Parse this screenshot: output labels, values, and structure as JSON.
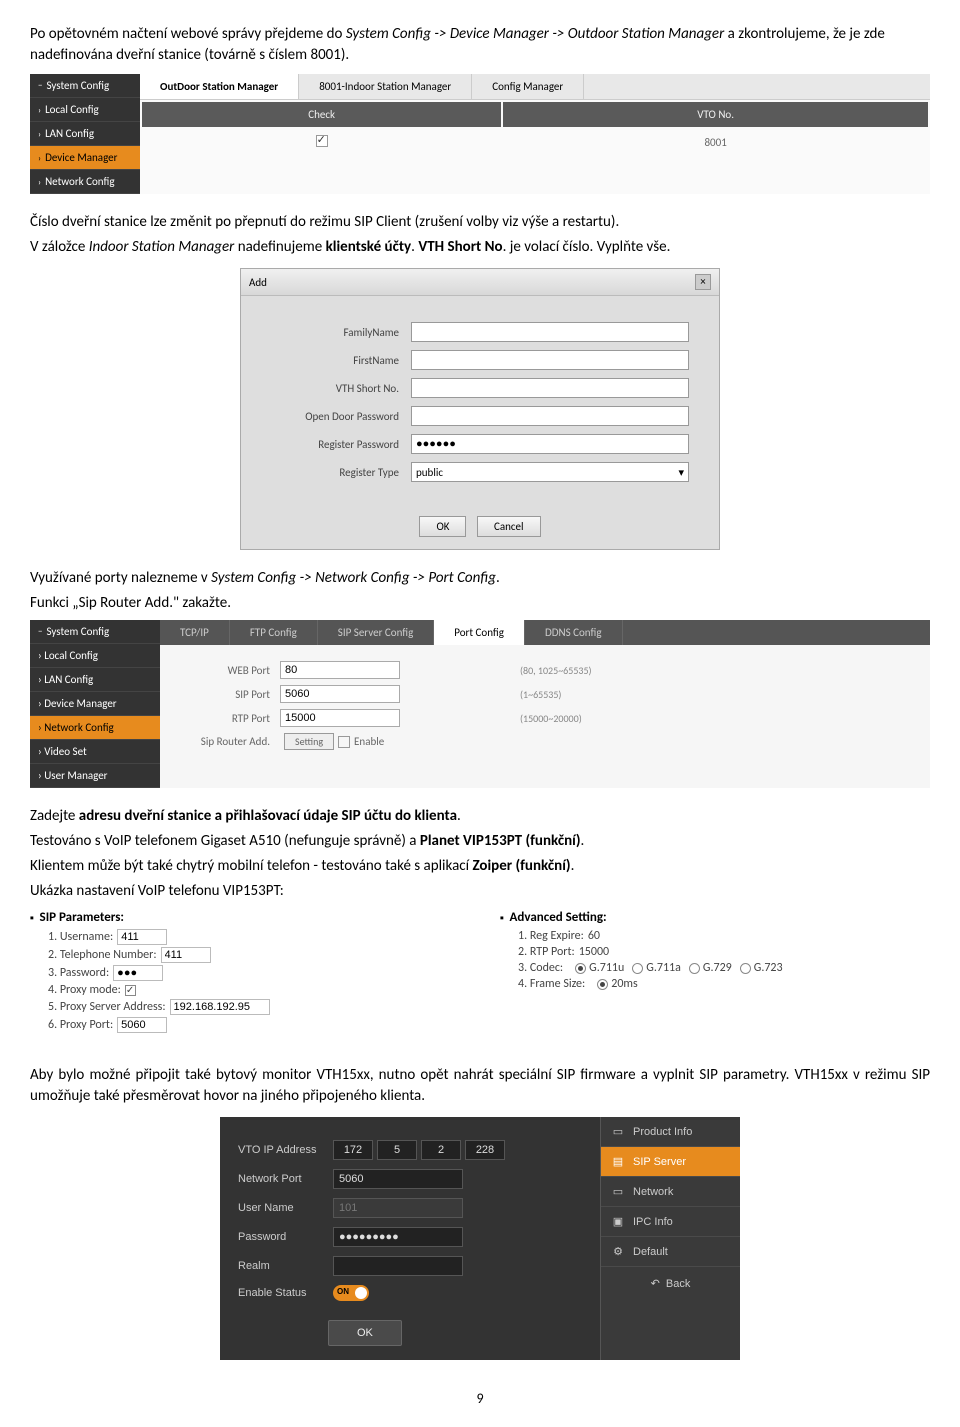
{
  "p1": "Po opětovném načtení webové správy přejdeme do ",
  "p1_italic": "System Config -> Device Manager -> Outdoor Station Manager",
  "p1_end": " a zkontrolujeme, že je zde nadefinována dveřní stanice (továrně s číslem 8001).",
  "shot1": {
    "side_title": "System Config",
    "side_items": [
      "Local Config",
      "LAN Config",
      "Device Manager",
      "Network Config"
    ],
    "side_active_index": 2,
    "tabs": [
      "OutDoor Station Manager",
      "8001-Indoor Station Manager",
      "Config Manager"
    ],
    "tab_active_index": 0,
    "th_check": "Check",
    "th_vto": "VTO No.",
    "row_vto": "8001"
  },
  "p2": "Číslo dveřní stanice lze změnit po přepnutí do režimu SIP Client (zrušení volby viz výše a restartu).",
  "p3_a": "V záložce ",
  "p3_italic": "Indoor Station Manager",
  "p3_b": " nadefinujeme ",
  "p3_bold1": "klientské účty",
  "p3_c": ". ",
  "p3_bold2": "VTH Short No",
  "p3_d": ". je volací číslo. Vyplňte vše.",
  "shot2": {
    "title": "Add",
    "labels": [
      "FamilyName",
      "FirstName",
      "VTH Short No.",
      "Open Door Password",
      "Register Password",
      "Register Type"
    ],
    "register_password": "●●●●●●",
    "register_type": "public",
    "ok": "OK",
    "cancel": "Cancel"
  },
  "p4_a": "Využívané porty nalezneme v ",
  "p4_italic": "System Config -> Network Config  -> Port Config",
  "p4_b": ".",
  "p5": "Funkci „Sip Router Add.\" zakažte.",
  "shot3": {
    "side_title": "System Config",
    "side_items": [
      "Local Config",
      "LAN Config",
      "Device Manager",
      "Network Config",
      "Video Set",
      "User Manager"
    ],
    "side_active_index": 3,
    "tabs": [
      "TCP/IP",
      "FTP Config",
      "SIP Server Config",
      "Port Config",
      "DDNS Config"
    ],
    "tab_active_index": 3,
    "rows": [
      {
        "label": "WEB Port",
        "value": "80",
        "hint": "(80, 1025~65535)"
      },
      {
        "label": "SIP Port",
        "value": "5060",
        "hint": "(1~65535)"
      },
      {
        "label": "RTP Port",
        "value": "15000",
        "hint": "(15000~20000)"
      }
    ],
    "router_label": "Sip Router Add.",
    "router_btn": "Setting",
    "router_enable": "Enable"
  },
  "p6_a": "Zadejte ",
  "p6_bold": "adresu dveřní stanice a přihlašovací údaje SIP účtu do klienta",
  "p6_b": ".",
  "p7_a": "Testováno s VoIP telefonem Gigaset A510 (nefunguje správně) a ",
  "p7_bold": "Planet VIP153PT (funkční)",
  "p7_b": ".",
  "p8_a": "Klientem může být také chytrý mobilní telefon - testováno také s aplikací ",
  "p8_bold": "Zoiper (funkční)",
  "p8_b": ".",
  "p9": "Ukázka nastavení VoIP telefonu VIP153PT:",
  "shot4": {
    "left_title": "SIP Parameters:",
    "left": [
      {
        "n": "1.",
        "label": "Username:",
        "value": "411"
      },
      {
        "n": "2.",
        "label": "Telephone Number:",
        "value": "411"
      },
      {
        "n": "3.",
        "label": "Password:",
        "value": "●●●"
      },
      {
        "n": "4.",
        "label": "Proxy mode:",
        "checkbox": true
      },
      {
        "n": "5.",
        "label": "Proxy Server Address:",
        "value": "192.168.192.95"
      },
      {
        "n": "6.",
        "label": "Proxy Port:",
        "value": "5060"
      }
    ],
    "right_title": "Advanced Setting:",
    "r1": {
      "n": "1.",
      "label": "Reg Expire:",
      "value": "60"
    },
    "r2": {
      "n": "2.",
      "label": "RTP Port:",
      "value": "15000"
    },
    "r3": {
      "n": "3.",
      "label": "Codec:",
      "options": [
        "G.711u",
        "G.711a",
        "G.729",
        "G.723"
      ],
      "checked": 0
    },
    "r4": {
      "n": "4.",
      "label": "Frame Size:",
      "options": [
        "20ms"
      ],
      "checked": 0
    }
  },
  "p10": "Aby bylo možné připojit také bytový monitor VTH15xx, nutno opět nahrát speciální SIP firmware a vyplnit SIP parametry. VTH15xx v režimu SIP umožňuje také přesměrovat hovor na jiného připojeného klienta.",
  "shot5": {
    "rows": [
      {
        "label": "VTO IP Address",
        "type": "ip",
        "value": [
          "172",
          "5",
          "2",
          "228"
        ]
      },
      {
        "label": "Network Port",
        "type": "text",
        "value": "5060"
      },
      {
        "label": "User Name",
        "type": "disabled",
        "value": "101"
      },
      {
        "label": "Password",
        "type": "password",
        "value": "●●●●●●●●●"
      },
      {
        "label": "Realm",
        "type": "text",
        "value": ""
      },
      {
        "label": "Enable Status",
        "type": "toggle",
        "value": "ON"
      }
    ],
    "ok": "OK",
    "menu": [
      {
        "icon": "▭",
        "label": "Product Info"
      },
      {
        "icon": "▤",
        "label": "SIP Server"
      },
      {
        "icon": "▭",
        "label": "Network"
      },
      {
        "icon": "▣",
        "label": "IPC Info"
      },
      {
        "icon": "⚙",
        "label": "Default"
      }
    ],
    "menu_active_index": 1,
    "back": "Back"
  },
  "page_number": "9"
}
